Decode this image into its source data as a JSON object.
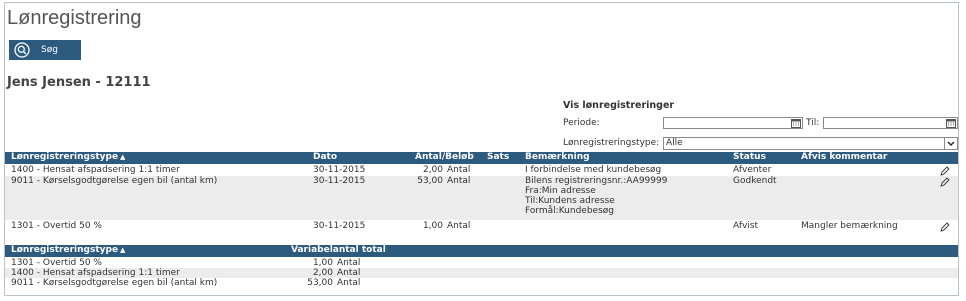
{
  "page": {
    "title": "Lønregistrering"
  },
  "search": {
    "label": "Søg"
  },
  "person": {
    "name": "Jens Jensen - 12111"
  },
  "filter": {
    "heading": "Vis lønregistreringer",
    "periode_label": "Periode:",
    "til_label": "Til:",
    "periode_value": "",
    "til_value": "",
    "type_label": "Lønregistreringstype:",
    "type_selected": "Alle"
  },
  "table": {
    "headers": {
      "type": "Lønregistreringstype",
      "sort": "▲",
      "dato": "Dato",
      "antal": "Antal/Beløb",
      "sats": "Sats",
      "bemaerkning": "Bemærkning",
      "status": "Status",
      "afvis": "Afvis kommentar"
    },
    "rows": [
      {
        "type": "1400 - Hensat afspadsering 1:1 timer",
        "dato": "30-11-2015",
        "amount": "2,00",
        "unit": "Antal",
        "sats": "",
        "bem": [
          "I forbindelse med kundebesøg"
        ],
        "status": "Afventer",
        "afvis": ""
      },
      {
        "type": "9011 - Kørselsgodtgørelse egen bil (antal km)",
        "dato": "30-11-2015",
        "amount": "53,00",
        "unit": "Antal",
        "sats": "",
        "bem": [
          "Bilens registreringsnr.:AA99999",
          "Fra:Min adresse",
          "Til:Kundens adresse",
          "Formål:Kundebesøg"
        ],
        "status": "Godkendt",
        "afvis": ""
      },
      {
        "type": "1301 - Overtid 50 %",
        "dato": "30-11-2015",
        "amount": "1,00",
        "unit": "Antal",
        "sats": "",
        "bem": [
          ""
        ],
        "status": "Afvist",
        "afvis": "Mangler bemærkning"
      }
    ]
  },
  "summary": {
    "headers": {
      "type": "Lønregistreringstype",
      "sort": "▲",
      "total": "Variabelantal total"
    },
    "rows": [
      {
        "type": "1301 - Overtid 50 %",
        "amount": "1,00",
        "unit": "Antal"
      },
      {
        "type": "1400 - Hensat afspadsering 1:1 timer",
        "amount": "2,00",
        "unit": "Antal"
      },
      {
        "type": "9011 - Kørselsgodtgørelse egen bil (antal km)",
        "amount": "53,00",
        "unit": "Antal"
      }
    ]
  },
  "colors": {
    "header_bg": "#2d5a7f",
    "row_alt": "#ececec"
  },
  "icons": {
    "search": "search-icon",
    "calendar": "calendar-icon",
    "edit": "pencil-icon",
    "dropdown": "chevron-down-icon"
  }
}
